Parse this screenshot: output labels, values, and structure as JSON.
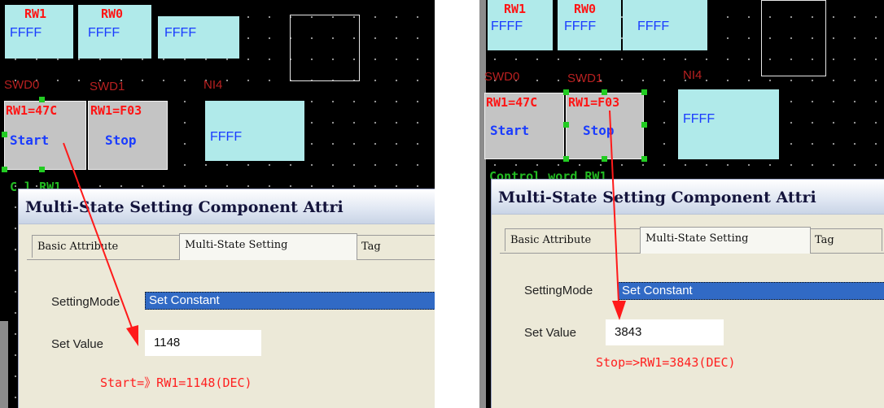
{
  "colors": {
    "canvas": "#000000",
    "cell_fill": "#b0eaea",
    "button_fill": "#c4c4c4",
    "address_red": "#ff1414",
    "value_blue": "#1a3cff",
    "handle_green": "#22cc22",
    "arrow_red": "#ff1a1a",
    "select_blue": "#316ac5"
  },
  "left": {
    "cells": {
      "rw1": "RW1",
      "rw0": "RW0",
      "rw1_value": "FFFF",
      "rw0_value": "FFFF",
      "wide_value": "FFFF"
    },
    "labels": {
      "swd0": "SWD0",
      "swd1": "SWD1",
      "ni4": "NI4"
    },
    "buttons": {
      "start_address": "RW1=47C",
      "start_label": "Start",
      "stop_address": "RW1=F03",
      "stop_label": "Stop"
    },
    "ni4_value": "FFFF",
    "green_text": "C      l       RW1",
    "dialog": {
      "title": "Multi-State Setting Component Attri",
      "tabs": [
        "Basic Attribute",
        "Multi-State Setting",
        "Tag"
      ],
      "setting_mode_label": "SettingMode",
      "setting_mode_value": "Set Constant",
      "set_value_label": "Set Value",
      "set_value": "1148",
      "note": "Start=》RW1=1148(DEC)"
    }
  },
  "right": {
    "cells": {
      "rw1": "RW1",
      "rw0": "RW0",
      "rw1_value": "FFFF",
      "rw0_value": "FFFF",
      "wide_value": "FFFF"
    },
    "labels": {
      "swd0": "SWD0",
      "swd1": "SWD1",
      "ni4": "NI4"
    },
    "buttons": {
      "start_address": "RW1=47C",
      "start_label": "Start",
      "stop_address": "RW1=F03",
      "stop_label": "Stop"
    },
    "ni4_value": "FFFF",
    "green_text": "Control word RW1",
    "dialog": {
      "title": "Multi-State Setting Component Attri",
      "tabs": [
        "Basic Attribute",
        "Multi-State Setting",
        "Tag"
      ],
      "setting_mode_label": "SettingMode",
      "setting_mode_value": "Set Constant",
      "set_value_label": "Set Value",
      "set_value": "3843",
      "note": "Stop=>RW1=3843(DEC)"
    }
  }
}
